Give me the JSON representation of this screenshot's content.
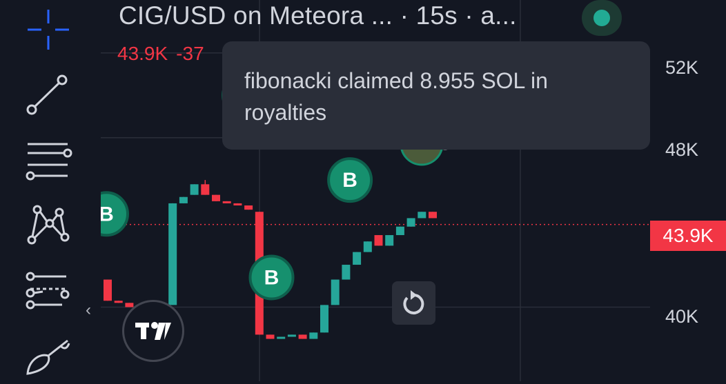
{
  "header": {
    "title": "CIG/USD on Meteora ... · 15s · a...",
    "price": "43.9K",
    "change": "-37"
  },
  "toast": {
    "message": "fibonacki claimed 8.955 SOL in royalties"
  },
  "toolbar": {
    "tools": [
      "crosshair-icon",
      "trend-line-icon",
      "horizontal-lines-icon",
      "pattern-icon",
      "fib-retracement-icon",
      "brush-icon"
    ],
    "collapse_icon": "‹"
  },
  "markers": {
    "buy_label": "B"
  },
  "colors": {
    "up": "#26a69a",
    "down": "#f23645",
    "background": "#131722",
    "grid": "#2a2e39",
    "marker": "#16906e"
  },
  "chart_data": {
    "type": "candlestick",
    "y_ticks": [
      "52K",
      "48K",
      "40K"
    ],
    "y_range": [
      36500,
      54500
    ],
    "last_price": 43900,
    "last_price_label": "43.9K",
    "candles": [
      {
        "o": 41300,
        "h": 41300,
        "l": 40300,
        "c": 40300
      },
      {
        "o": 40300,
        "h": 40300,
        "l": 40200,
        "c": 40200
      },
      {
        "o": 40200,
        "h": 40200,
        "l": 40000,
        "c": 40000
      },
      {
        "o": 40100,
        "h": 40100,
        "l": 39900,
        "c": 39900
      },
      {
        "o": 39900,
        "h": 40000,
        "l": 39800,
        "c": 39800
      },
      {
        "o": 39800,
        "h": 40000,
        "l": 39700,
        "c": 40000
      },
      {
        "o": 40100,
        "h": 44900,
        "l": 40100,
        "c": 44900
      },
      {
        "o": 44900,
        "h": 45200,
        "l": 44900,
        "c": 45200
      },
      {
        "o": 45300,
        "h": 45800,
        "l": 45300,
        "c": 45800
      },
      {
        "o": 45800,
        "h": 46000,
        "l": 45300,
        "c": 45300
      },
      {
        "o": 45300,
        "h": 45300,
        "l": 45000,
        "c": 45000
      },
      {
        "o": 45000,
        "h": 45000,
        "l": 44900,
        "c": 44900
      },
      {
        "o": 44900,
        "h": 44900,
        "l": 44800,
        "c": 44800
      },
      {
        "o": 44800,
        "h": 44800,
        "l": 44600,
        "c": 44600
      },
      {
        "o": 44500,
        "h": 44500,
        "l": 38700,
        "c": 38700
      },
      {
        "o": 38700,
        "h": 38700,
        "l": 38500,
        "c": 38500
      },
      {
        "o": 38500,
        "h": 38600,
        "l": 38500,
        "c": 38600
      },
      {
        "o": 38600,
        "h": 38700,
        "l": 38600,
        "c": 38700
      },
      {
        "o": 38700,
        "h": 38700,
        "l": 38500,
        "c": 38500
      },
      {
        "o": 38500,
        "h": 38800,
        "l": 38500,
        "c": 38800
      },
      {
        "o": 38800,
        "h": 40100,
        "l": 38800,
        "c": 40100
      },
      {
        "o": 40100,
        "h": 41300,
        "l": 40100,
        "c": 41300
      },
      {
        "o": 41300,
        "h": 42000,
        "l": 41300,
        "c": 42000
      },
      {
        "o": 42000,
        "h": 42600,
        "l": 42000,
        "c": 42600
      },
      {
        "o": 42600,
        "h": 43100,
        "l": 42600,
        "c": 43100
      },
      {
        "o": 43400,
        "h": 43400,
        "l": 42900,
        "c": 42900
      },
      {
        "o": 42900,
        "h": 43400,
        "l": 42900,
        "c": 43400
      },
      {
        "o": 43400,
        "h": 43800,
        "l": 43400,
        "c": 43800
      },
      {
        "o": 43800,
        "h": 44200,
        "l": 43800,
        "c": 44200
      },
      {
        "o": 44200,
        "h": 44500,
        "l": 44200,
        "c": 44500
      },
      {
        "o": 44500,
        "h": 44500,
        "l": 44200,
        "c": 44200
      }
    ]
  }
}
